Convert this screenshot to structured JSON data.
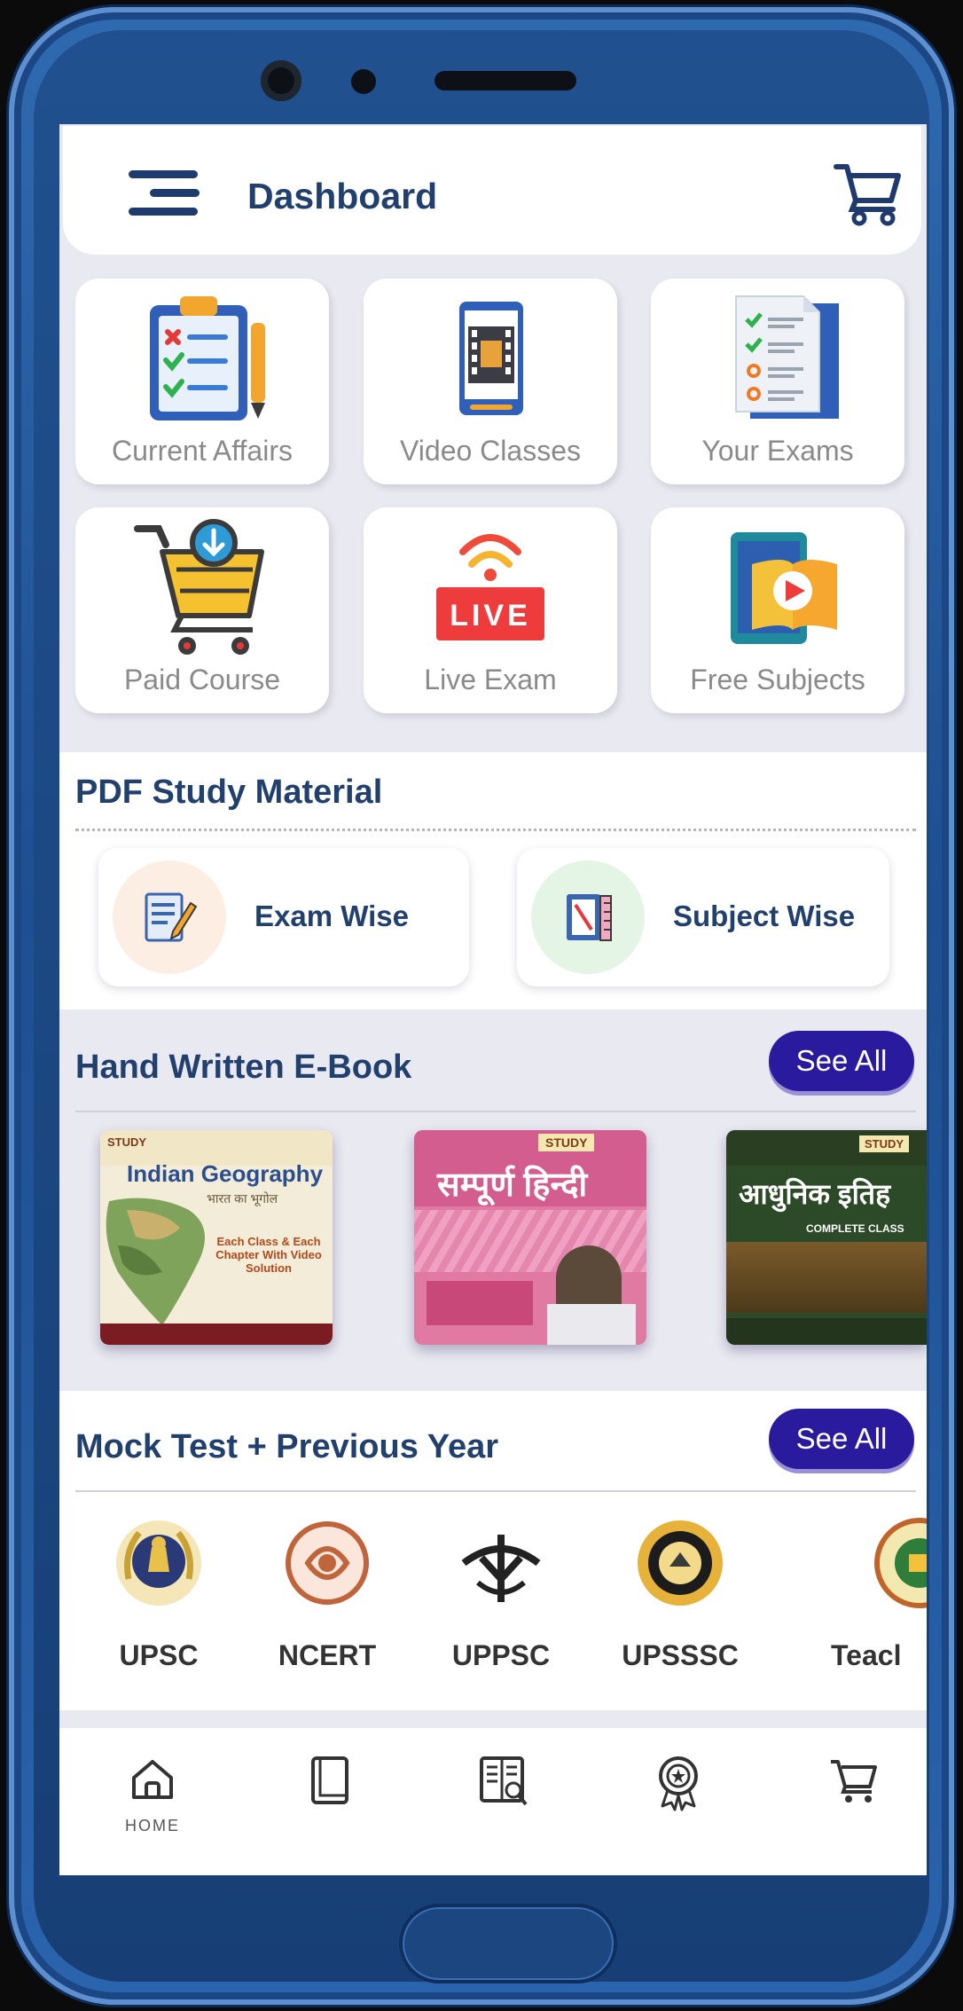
{
  "topbar": {
    "title": "Dashboard"
  },
  "tiles": [
    {
      "label": "Current Affairs",
      "icon": "clipboard-checklist-icon"
    },
    {
      "label": "Video Classes",
      "icon": "video-phone-icon"
    },
    {
      "label": "Your Exams",
      "icon": "exam-document-icon"
    },
    {
      "label": "Paid Course",
      "icon": "shopping-cart-download-icon"
    },
    {
      "label": "Live Exam",
      "icon": "live-broadcast-icon",
      "badge": "LIVE"
    },
    {
      "label": "Free Subjects",
      "icon": "tablet-book-play-icon"
    }
  ],
  "pdf": {
    "title": "PDF Study Material",
    "cards": [
      {
        "label": "Exam Wise",
        "icon": "notepad-pencil-icon"
      },
      {
        "label": "Subject Wise",
        "icon": "book-ruler-icon"
      }
    ]
  },
  "ebook": {
    "title": "Hand Written E-Book",
    "see_all": "See All",
    "books": [
      {
        "title": "Indian Geography",
        "subtitle": "भारत का भूगोल",
        "note": "Each Class & Each Chapter With Video Solution",
        "brand": "STUDY"
      },
      {
        "title": "सम्पूर्ण हिन्दी",
        "brand": "STUDY"
      },
      {
        "title": "आधुनिक इतिह",
        "subtitle": "COMPLETE CLASS",
        "brand": "STUDY"
      }
    ]
  },
  "mock": {
    "title": "Mock Test + Previous Year",
    "see_all": "See All",
    "exams": [
      {
        "label": "UPSC",
        "icon": "upsc-emblem-icon"
      },
      {
        "label": "NCERT",
        "icon": "ncert-logo-icon"
      },
      {
        "label": "UPPSC",
        "icon": "uppsc-emblem-icon"
      },
      {
        "label": "UPSSSC",
        "icon": "upsssc-seal-icon"
      },
      {
        "label": "Teacl",
        "icon": "teacher-exam-logo-icon"
      }
    ]
  },
  "bottom_nav": {
    "items": [
      {
        "label": "HOME",
        "icon": "home-icon"
      },
      {
        "icon": "book-icon"
      },
      {
        "icon": "reading-book-icon"
      },
      {
        "icon": "award-badge-icon"
      },
      {
        "icon": "cart-icon"
      }
    ]
  },
  "colors": {
    "primary": "#22406e",
    "see_all_bg": "#2a1a9e",
    "screen_bg": "#e9e9f1",
    "phone_frame": "#1d4f91"
  }
}
